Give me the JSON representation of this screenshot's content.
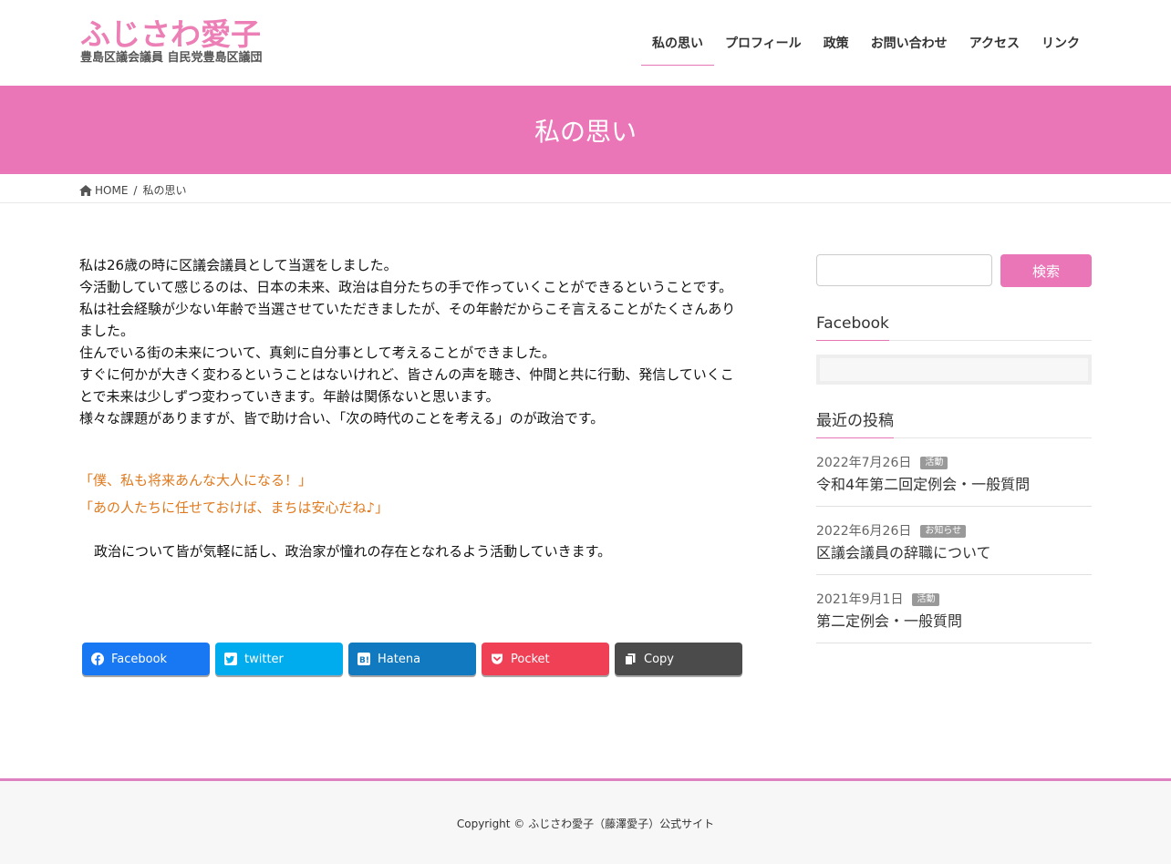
{
  "header": {
    "logo_main": "ふじさわ愛子",
    "logo_sub": "豊島区議会議員 自民党豊島区議団",
    "nav": [
      {
        "label": "私の思い",
        "active": true
      },
      {
        "label": "プロフィール"
      },
      {
        "label": "政策"
      },
      {
        "label": "お問い合わせ"
      },
      {
        "label": "アクセス"
      },
      {
        "label": "リンク"
      }
    ]
  },
  "page": {
    "title": "私の思い"
  },
  "breadcrumb": {
    "home": "HOME",
    "separator": "/",
    "current": "私の思い"
  },
  "content": {
    "paragraphs": [
      "私は26歳の時に区議会議員として当選をしました。",
      "今活動していて感じるのは、日本の未来、政治は自分たちの手で作っていくことができるということです。",
      "私は社会経験が少ない年齢で当選させていただきましたが、その年齢だからこそ言えることがたくさんありました。",
      "住んでいる街の未来について、真剣に自分事として考えることができました。",
      "すぐに何かが大きく変わるということはないけれど、皆さんの声を聴き、仲間と共に行動、発信していくことで未来は少しずつ変わっていきます。年齢は関係ないと思います。",
      "様々な課題がありますが、皆で助け合い、「次の時代のことを考える」のが政治です。"
    ],
    "quotes": [
      "「僕、私も将来あんな大人になる！」",
      "「あの人たちに任せておけば、まちは安心だね♪」"
    ],
    "closing": "政治について皆が気軽に話し、政治家が憧れの存在となれるよう活動していきます。"
  },
  "share": {
    "facebook": "Facebook",
    "twitter": "twitter",
    "hatena": "Hatena",
    "pocket": "Pocket",
    "copy": "Copy"
  },
  "sidebar": {
    "search_button": "検索",
    "search_value": "",
    "facebook_title": "Facebook",
    "recent_title": "最近の投稿",
    "posts": [
      {
        "date": "2022年7月26日",
        "category": "活動",
        "title": "令和4年第二回定例会・一般質問"
      },
      {
        "date": "2022年6月26日",
        "category": "お知らせ",
        "title": "区議会議員の辞職について"
      },
      {
        "date": "2021年9月1日",
        "category": "活動",
        "title": "第二定例会・一般質問"
      }
    ]
  },
  "footer": {
    "copyright": "Copyright © ふじさわ愛子（藤澤愛子）公式サイト"
  },
  "colors": {
    "accent": "#ea76b8",
    "quote": "#e07a1f",
    "footer_border": "#dd81c1"
  }
}
